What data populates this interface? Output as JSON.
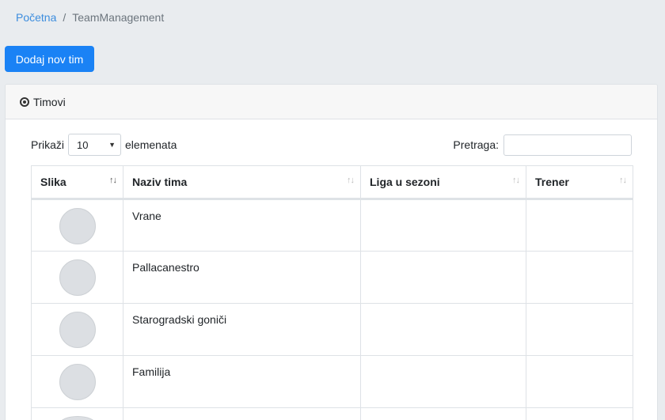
{
  "breadcrumb": {
    "home": "Početna",
    "separator": "/",
    "current": "TeamManagement"
  },
  "toolbar": {
    "add_team_label": "Dodaj nov tim"
  },
  "card": {
    "title": "Timovi"
  },
  "controls": {
    "show_prefix": "Prikaži",
    "page_size": "10",
    "show_suffix": "elemenata",
    "search_label": "Pretraga:",
    "search_value": ""
  },
  "table": {
    "headers": [
      "Slika",
      "Naziv tima",
      "Liga u sezoni",
      "Trener"
    ],
    "rows": [
      {
        "name": "Vrane",
        "league": "",
        "coach": ""
      },
      {
        "name": "Pallacanestro",
        "league": "",
        "coach": ""
      },
      {
        "name": "Starogradski goniči",
        "league": "",
        "coach": ""
      },
      {
        "name": "Familija",
        "league": "",
        "coach": ""
      },
      {
        "name": "",
        "league": "",
        "coach": ""
      }
    ]
  },
  "colors": {
    "primary": "#1a82f5",
    "link": "#3c8dde",
    "background": "#e9ecef"
  }
}
